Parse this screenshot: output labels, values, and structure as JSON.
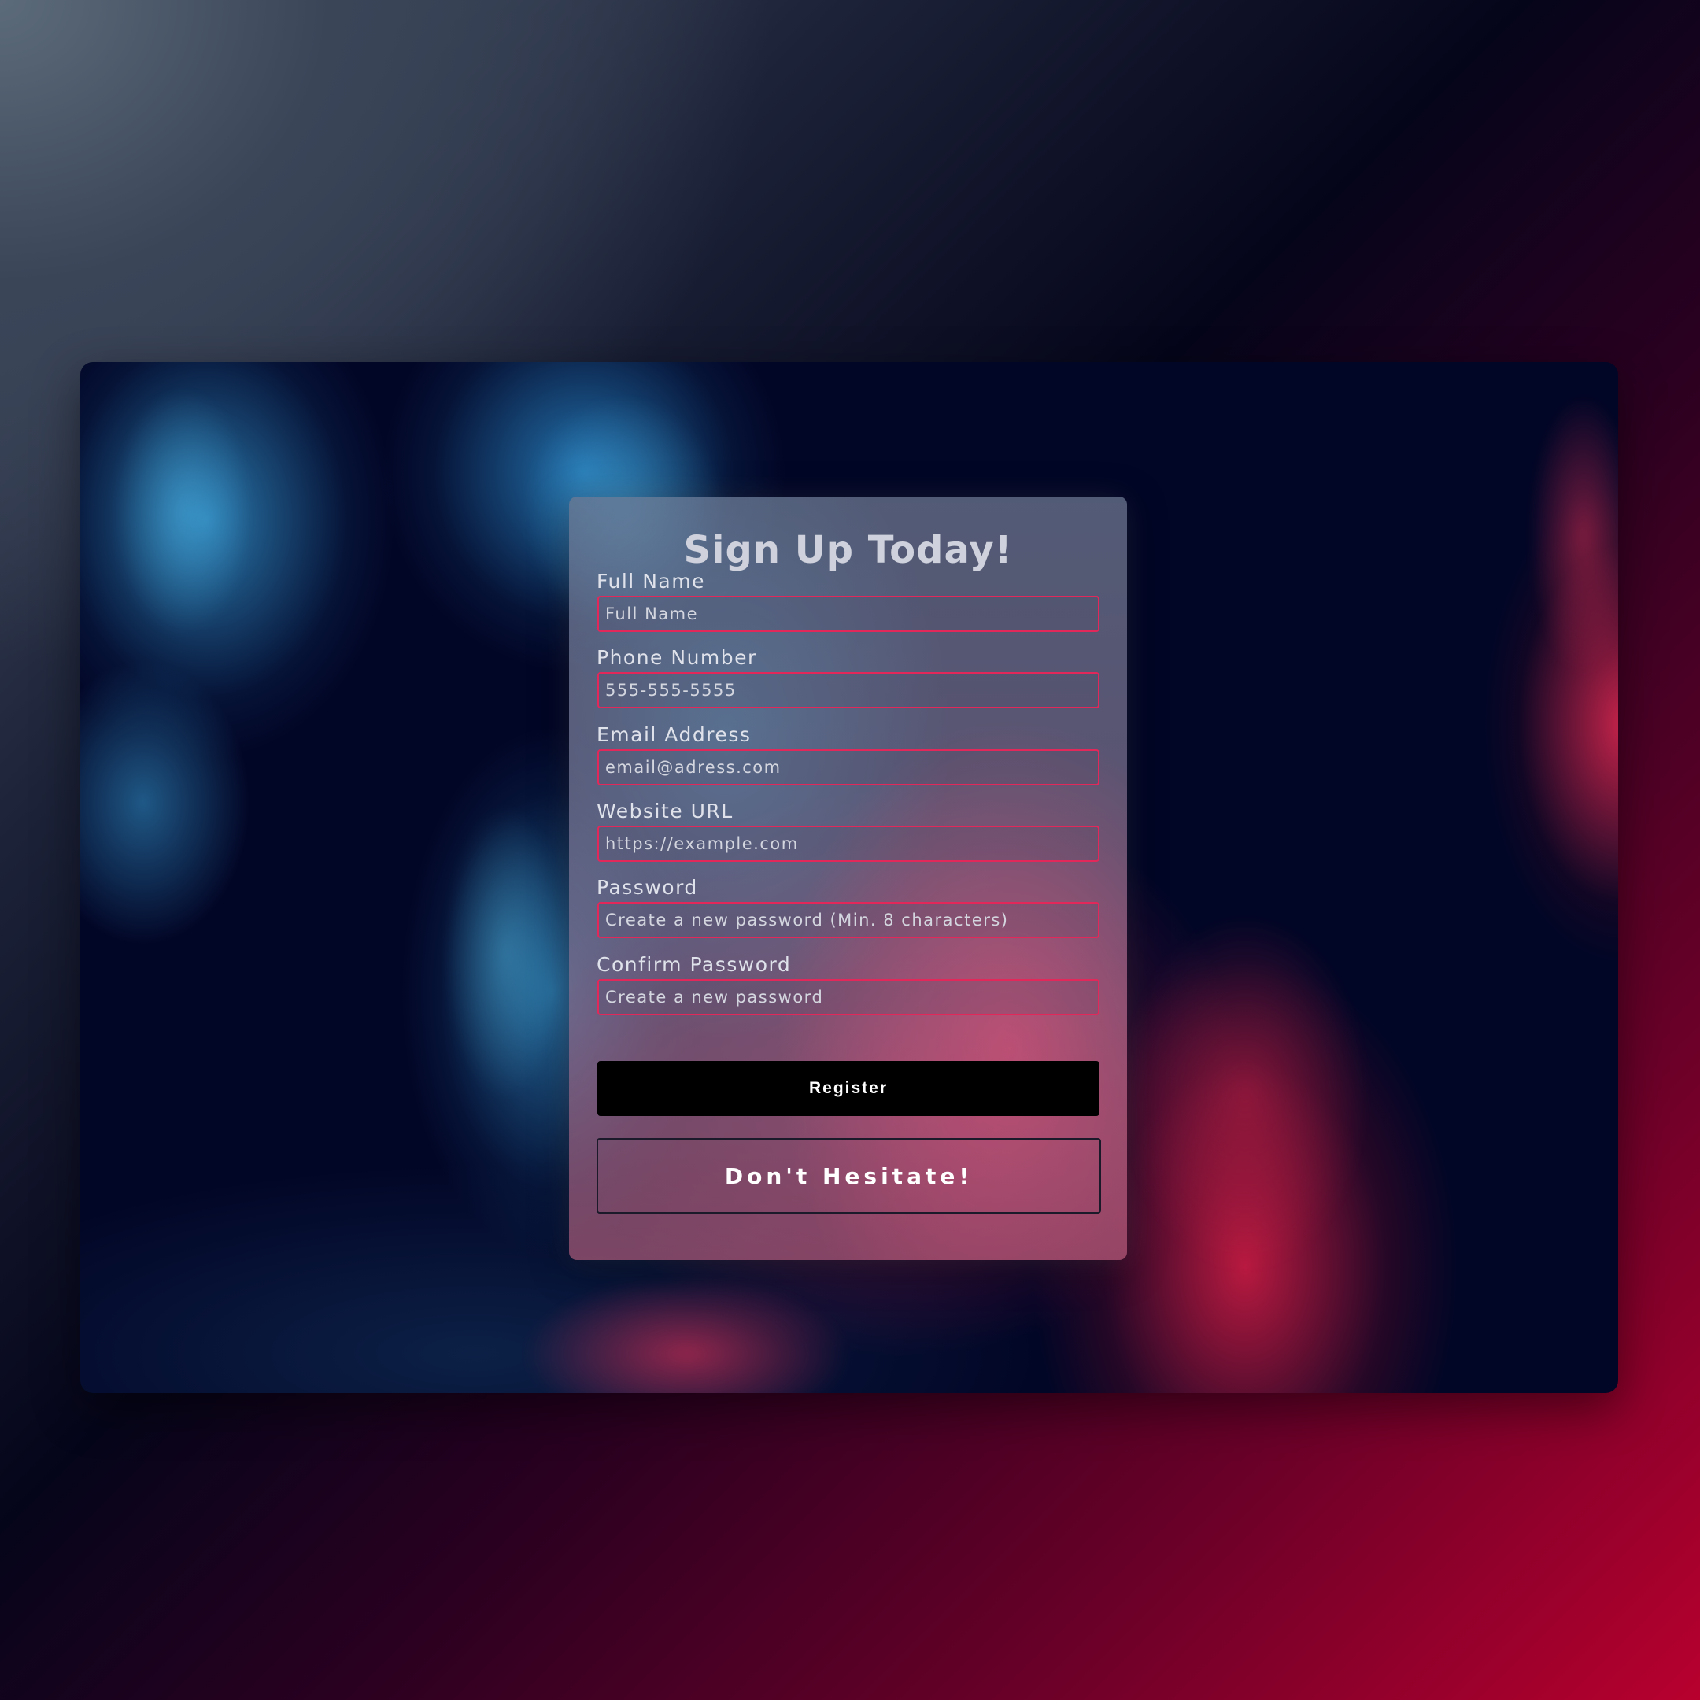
{
  "form": {
    "title": "Sign Up Today!",
    "fields": [
      {
        "label": "Full Name",
        "placeholder": "Full Name",
        "value": ""
      },
      {
        "label": "Phone Number",
        "placeholder": "555-555-5555",
        "value": ""
      },
      {
        "label": "Email Address",
        "placeholder": "email@adress.com",
        "value": ""
      },
      {
        "label": "Website URL",
        "placeholder": "https://example.com",
        "value": ""
      },
      {
        "label": "Password",
        "placeholder": "Create a new password (Min. 8 characters)",
        "value": ""
      },
      {
        "label": "Confirm Password",
        "placeholder": "Create a new password",
        "value": ""
      }
    ],
    "register_label": "Register",
    "secondary_label": "Don't Hesitate!"
  },
  "colors": {
    "input_border": "#e2285a",
    "register_bg": "#000000",
    "title_text": "#cfd2dc"
  }
}
